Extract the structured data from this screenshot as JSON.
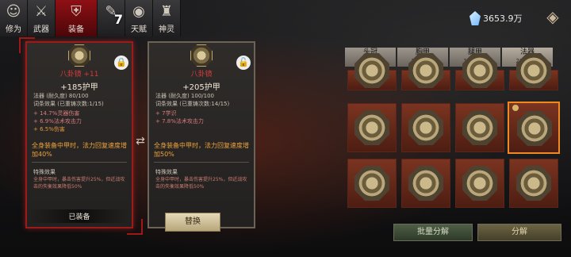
{
  "tabs": [
    {
      "label": "修为",
      "icon": "portrait-icon"
    },
    {
      "label": "武器",
      "icon": "crossed-swords-icon"
    },
    {
      "label": "装备",
      "icon": "armor-icon"
    },
    {
      "label": "",
      "icon": "scroll-icon",
      "badge": "7"
    },
    {
      "label": "天赋",
      "icon": "talent-icon"
    },
    {
      "label": "神灵",
      "icon": "statue-icon"
    }
  ],
  "currency": {
    "amount": "3653.9万",
    "icon": "crystal-icon"
  },
  "equipped_card": {
    "name": "八卦镜 +11",
    "main_stat": "+185护甲",
    "type_line": "法器  (耐久度) 80/100",
    "affix_line": "词条效果  (已重铸次数:1/15)",
    "affixes": [
      "+ 14.7%灵器伤害",
      "+ 6.9%法术攻击力"
    ],
    "gold_affix": "+ 6.5%伤害",
    "highlight": "全身装备中甲时，法力回复速度增加40%",
    "set_title": "特殊效果",
    "set_desc": "全身中甲时，暴击伤害提升25%，但近战攻击的失衡效果降低50%",
    "equipped_label": "已装备"
  },
  "compare_card": {
    "name": "八卦镜",
    "main_stat": "+205护甲",
    "type_line": "法器  (耐久度) 100/100",
    "affix_line": "词条效果  (已重铸次数:14/15)",
    "affixes": [
      "+ 7学识",
      "+ 7.8%法术攻击力"
    ],
    "highlight": "全身装备中甲时，法力回复速度增加50%",
    "set_title": "特殊效果",
    "set_desc": "全身中甲时，暴击伤害提升25%，但近战攻击的失衡效果降低50%",
    "replace_label": "替换"
  },
  "categories": [
    {
      "name": "头冠",
      "count": "60/120"
    },
    {
      "name": "胸甲",
      "count": "134/152"
    },
    {
      "name": "腿甲",
      "count": "120/140"
    },
    {
      "name": "法器",
      "count": "217/328"
    }
  ],
  "buttons": {
    "batch": "批量分解",
    "decompose": "分解"
  }
}
